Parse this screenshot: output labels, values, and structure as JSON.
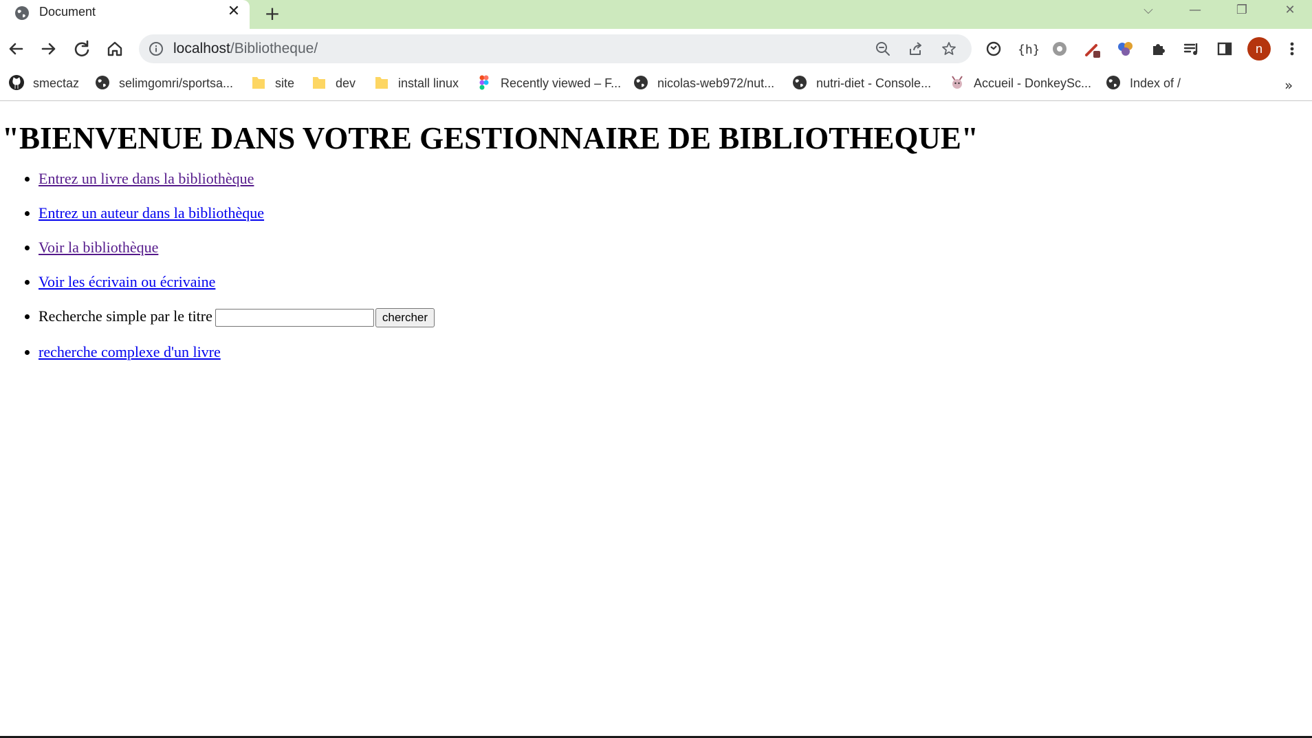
{
  "browser": {
    "tab": {
      "title": "Document",
      "favicon": "globe-icon",
      "close_label": "✕"
    },
    "new_tab_label": "+",
    "window_controls": {
      "dropdown": "⌵",
      "minimize": "—",
      "restore": "❐",
      "close": "✕"
    },
    "toolbar": {
      "url_host": "localhost",
      "url_path": "/Bibliotheque/",
      "avatar_letter": "n",
      "avatar_color": "#b5350e"
    },
    "bookmarks": [
      {
        "label": "smectaz",
        "icon": "github-icon"
      },
      {
        "label": "selimgomri/sportsa...",
        "icon": "globe-icon"
      },
      {
        "label": "site",
        "icon": "folder-icon"
      },
      {
        "label": "dev",
        "icon": "folder-icon"
      },
      {
        "label": "install linux",
        "icon": "folder-icon"
      },
      {
        "label": "Recently viewed – F...",
        "icon": "figma-icon"
      },
      {
        "label": "nicolas-web972/nut...",
        "icon": "globe-icon"
      },
      {
        "label": "nutri-diet - Console...",
        "icon": "globe-icon"
      },
      {
        "label": "Accueil - DonkeySc...",
        "icon": "donkey-icon"
      },
      {
        "label": "Index of /",
        "icon": "globe-icon"
      }
    ],
    "bookmarks_more": "»"
  },
  "page": {
    "heading": "\"BIENVENUE DANS VOTRE GESTIONNAIRE DE BIBLIOTHEQUE\"",
    "links": {
      "add_book": "Entrez un livre dans la bibliothèque",
      "add_author": "Entrez un auteur dans la bibliothèque",
      "view_library": "Voir la bibliothèque",
      "view_writers": "Voir les écrivain ou écrivaine",
      "complex_search": "recherche complexe d'un livre"
    },
    "simple_search": {
      "label": "Recherche simple par le titre",
      "value": "",
      "button_label": "chercher"
    },
    "colors": {
      "link": "#0000ee",
      "visited_link": "#551a8b",
      "tab_strip": "#cde9be"
    }
  }
}
